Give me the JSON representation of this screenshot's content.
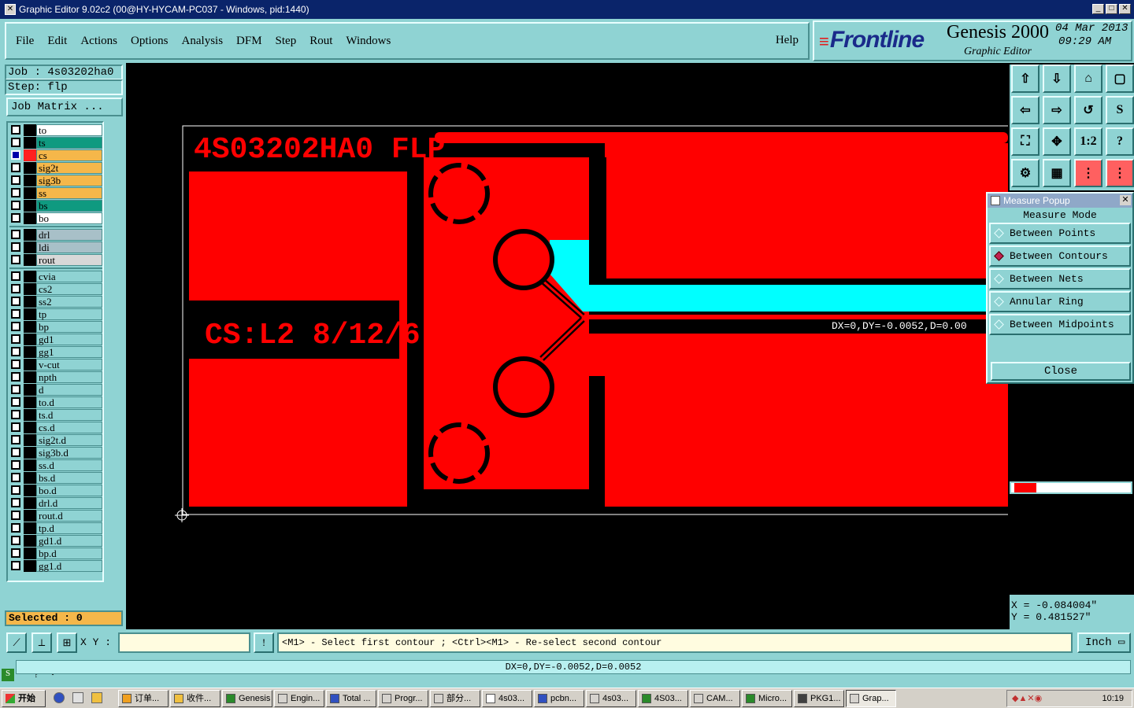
{
  "window": {
    "title": "Graphic Editor 9.02c2 (00@HY-HYCAM-PC037 - Windows, pid:1440)"
  },
  "menu": {
    "items": [
      "File",
      "Edit",
      "Actions",
      "Options",
      "Analysis",
      "DFM",
      "Step",
      "Rout",
      "Windows"
    ],
    "help": "Help"
  },
  "brand": {
    "logo": "Frontline",
    "product": "Genesis 2000",
    "subtitle": "Graphic Editor",
    "date": "04 Mar 2013",
    "time": "09:29 AM"
  },
  "job": {
    "job_label": "Job : 4s03202ha0",
    "step_label": "Step: flp",
    "matrix_button": "Job Matrix ..."
  },
  "layers": [
    {
      "name": "to",
      "color": "#ffffff",
      "sw": "#000000"
    },
    {
      "name": "ts",
      "color": "#0f9a80",
      "sw": "#000000"
    },
    {
      "name": "cs",
      "color": "#f5b74a",
      "sw": "#ff2020",
      "active": true
    },
    {
      "name": "sig2t",
      "color": "#f5b74a",
      "sw": "#000000"
    },
    {
      "name": "sig3b",
      "color": "#f5b74a",
      "sw": "#000000"
    },
    {
      "name": "ss",
      "color": "#f5b74a",
      "sw": "#000000"
    },
    {
      "name": "bs",
      "color": "#0f9a80",
      "sw": "#000000"
    },
    {
      "name": "bo",
      "color": "#ffffff",
      "sw": "#000000"
    },
    {
      "name": "drl",
      "color": "#a8c0c8",
      "sw": "#000000",
      "gap": true
    },
    {
      "name": "ldi",
      "color": "#a8c0c8",
      "sw": "#000000"
    },
    {
      "name": "rout",
      "color": "#d8d8d8",
      "sw": "#000000"
    },
    {
      "name": "cvia",
      "color": "#8fd3d3",
      "sw": "#000000",
      "gap": true
    },
    {
      "name": "cs2",
      "color": "#8fd3d3",
      "sw": "#000000"
    },
    {
      "name": "ss2",
      "color": "#8fd3d3",
      "sw": "#000000"
    },
    {
      "name": "tp",
      "color": "#8fd3d3",
      "sw": "#000000"
    },
    {
      "name": "bp",
      "color": "#8fd3d3",
      "sw": "#000000"
    },
    {
      "name": "gd1",
      "color": "#8fd3d3",
      "sw": "#000000"
    },
    {
      "name": "gg1",
      "color": "#8fd3d3",
      "sw": "#000000"
    },
    {
      "name": "v-cut",
      "color": "#8fd3d3",
      "sw": "#000000"
    },
    {
      "name": "npth",
      "color": "#8fd3d3",
      "sw": "#000000"
    },
    {
      "name": "d",
      "color": "#8fd3d3",
      "sw": "#000000"
    },
    {
      "name": "to.d",
      "color": "#8fd3d3",
      "sw": "#000000"
    },
    {
      "name": "ts.d",
      "color": "#8fd3d3",
      "sw": "#000000"
    },
    {
      "name": "cs.d",
      "color": "#8fd3d3",
      "sw": "#000000"
    },
    {
      "name": "sig2t.d",
      "color": "#8fd3d3",
      "sw": "#000000"
    },
    {
      "name": "sig3b.d",
      "color": "#8fd3d3",
      "sw": "#000000"
    },
    {
      "name": "ss.d",
      "color": "#8fd3d3",
      "sw": "#000000"
    },
    {
      "name": "bs.d",
      "color": "#8fd3d3",
      "sw": "#000000"
    },
    {
      "name": "bo.d",
      "color": "#8fd3d3",
      "sw": "#000000"
    },
    {
      "name": "drl.d",
      "color": "#8fd3d3",
      "sw": "#000000"
    },
    {
      "name": "rout.d",
      "color": "#8fd3d3",
      "sw": "#000000"
    },
    {
      "name": "tp.d",
      "color": "#8fd3d3",
      "sw": "#000000"
    },
    {
      "name": "gd1.d",
      "color": "#8fd3d3",
      "sw": "#000000"
    },
    {
      "name": "bp.d",
      "color": "#8fd3d3",
      "sw": "#000000"
    },
    {
      "name": "gg1.d",
      "color": "#8fd3d3",
      "sw": "#000000"
    }
  ],
  "selected": "Selected : 0",
  "canvas": {
    "title_text": "4S03202HA0 FLP",
    "label_text": "CS:L2 8/12/6",
    "measure_text": "DX=0,DY=-0.0052,D=0.00"
  },
  "tools": {
    "ratio_label": "1:2",
    "help_label": "?"
  },
  "measure_popup": {
    "title": "Measure Popup",
    "heading": "Measure Mode",
    "options": [
      {
        "label": "Between Points",
        "selected": false
      },
      {
        "label": "Between Contours",
        "selected": true
      },
      {
        "label": "Between Nets",
        "selected": false
      },
      {
        "label": "Annular Ring",
        "selected": false
      },
      {
        "label": "Between Midpoints",
        "selected": false
      }
    ],
    "close": "Close"
  },
  "coords": {
    "x": "X = -0.084004\"",
    "y": "Y = 0.481527\""
  },
  "cmd": {
    "xy_label": "X Y :",
    "xy_value": "",
    "prompt": "<M1> - Select first contour ; <Ctrl><M1> - Re-select second contour",
    "unit": "Inch"
  },
  "status": "DX=0,DY=-0.0052,D=0.0052",
  "taskbar": {
    "start": "开始",
    "tasks": [
      "订单...",
      "收件...",
      "Genesis",
      "Engin...",
      "Total ...",
      "Progr...",
      "部分...",
      "4s03...",
      "pcbn...",
      "4s03...",
      "4S03...",
      "CAM...",
      "Micro...",
      "PKG1...",
      "Grap..."
    ],
    "clock": "10:19"
  },
  "colors": {
    "copper": "#ff0000",
    "highlight": "#00ffff",
    "panel": "#8fd3d3"
  }
}
